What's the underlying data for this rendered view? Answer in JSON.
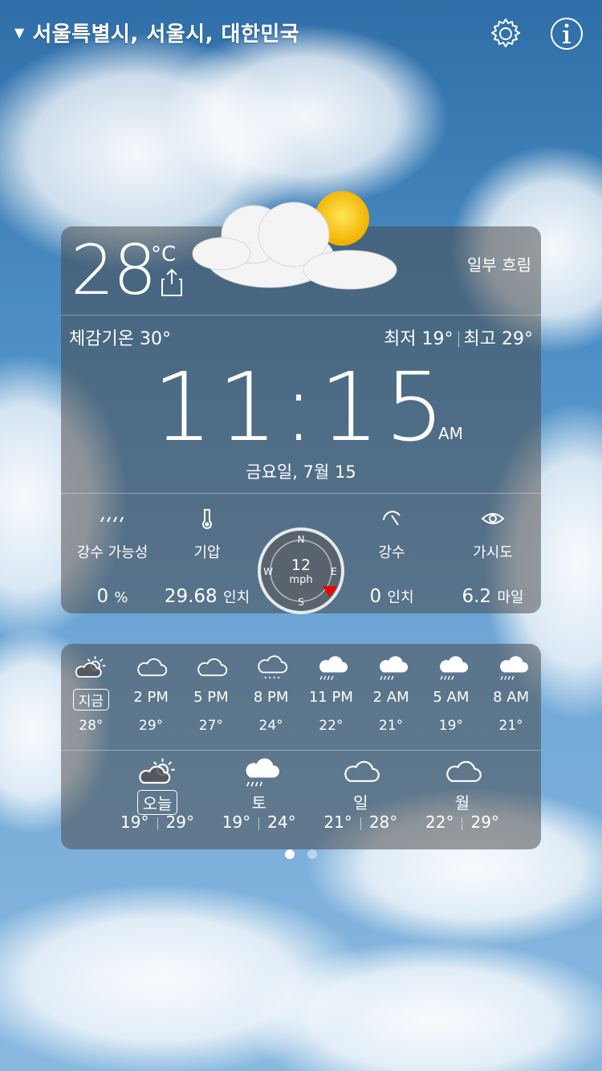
{
  "location": {
    "text": "서울특별시, 서울시, 대한민국"
  },
  "current": {
    "temp": "28",
    "unit": "°C",
    "condition": "일부 흐림",
    "feels_like": "체감기온 30°",
    "low": "최저 19°",
    "high": "최고 29°"
  },
  "clock": {
    "time": "11:15",
    "ampm": "AM",
    "date": "금요일, 7월 15"
  },
  "stats": [
    {
      "label": "강수 가능성",
      "value": "0",
      "unit": "%",
      "icon": "rain-drizzle-icon"
    },
    {
      "label": "기압",
      "value": "29.68",
      "unit": "인치",
      "icon": "thermometer-icon"
    },
    {
      "label": "강수",
      "value": "0",
      "unit": "인치",
      "icon": "umbrella-icon"
    },
    {
      "label": "가시도",
      "value": "6.2",
      "unit": "마일",
      "icon": "eye-icon"
    }
  ],
  "wind": {
    "speed": "12",
    "unit": "mph",
    "north": "N",
    "east": "E",
    "south": "S",
    "west": "W"
  },
  "hourly": [
    {
      "time": "지금",
      "temp": "28°",
      "icon": "partly-sunny-icon"
    },
    {
      "time": "2 PM",
      "temp": "29°",
      "icon": "cloud-icon"
    },
    {
      "time": "5 PM",
      "temp": "27°",
      "icon": "cloud-icon"
    },
    {
      "time": "8 PM",
      "temp": "24°",
      "icon": "cloud-drizzle-icon"
    },
    {
      "time": "11 PM",
      "temp": "22°",
      "icon": "cloud-rain-icon"
    },
    {
      "time": "2 AM",
      "temp": "21°",
      "icon": "cloud-rain-icon"
    },
    {
      "time": "5 AM",
      "temp": "19°",
      "icon": "cloud-rain-icon"
    },
    {
      "time": "8 AM",
      "temp": "21°",
      "icon": "cloud-rain-icon"
    }
  ],
  "daily": [
    {
      "day": "오늘",
      "low": "19°",
      "high": "29°",
      "icon": "partly-sunny-icon"
    },
    {
      "day": "토",
      "low": "19°",
      "high": "24°",
      "icon": "cloud-rain-icon"
    },
    {
      "day": "일",
      "low": "21°",
      "high": "28°",
      "icon": "cloud-icon"
    },
    {
      "day": "월",
      "low": "22°",
      "high": "29°",
      "icon": "cloud-icon"
    }
  ]
}
